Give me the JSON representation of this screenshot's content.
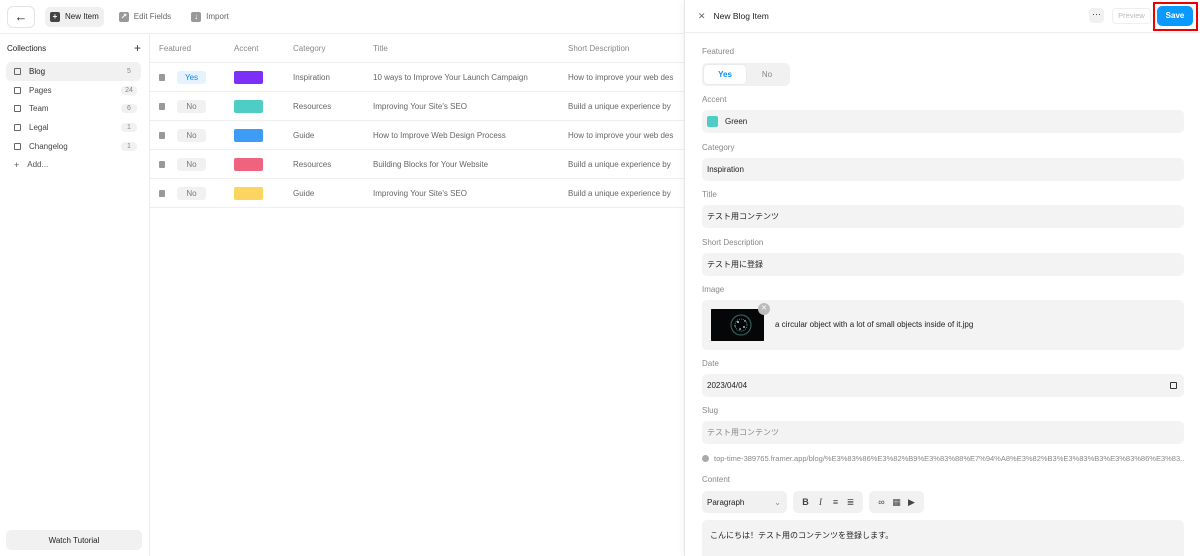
{
  "toolbar": {
    "back_icon": "arrow-left-icon",
    "new_item": "New Item",
    "edit_fields": "Edit Fields",
    "import": "Import"
  },
  "sidebar": {
    "title": "Collections",
    "items": [
      {
        "label": "Blog",
        "count": "5"
      },
      {
        "label": "Pages",
        "count": "24"
      },
      {
        "label": "Team",
        "count": "6"
      },
      {
        "label": "Legal",
        "count": "1"
      },
      {
        "label": "Changelog",
        "count": "1"
      }
    ],
    "add_label": "Add...",
    "watch_tutorial": "Watch Tutorial"
  },
  "table": {
    "headers": [
      "Featured",
      "Accent",
      "Category",
      "Title",
      "Short Description"
    ],
    "rows": [
      {
        "featured": "Yes",
        "accent": "#7b2ff7",
        "category": "Inspiration",
        "title": "10 ways to Improve Your Launch Campaign",
        "desc": "How to improve your web des"
      },
      {
        "featured": "No",
        "accent": "#4ecdc4",
        "category": "Resources",
        "title": "Improving Your Site's SEO",
        "desc": "Build a unique experience by"
      },
      {
        "featured": "No",
        "accent": "#3d9cf5",
        "category": "Guide",
        "title": "How to Improve Web Design Process",
        "desc": "How to improve your web des"
      },
      {
        "featured": "No",
        "accent": "#f0637f",
        "category": "Resources",
        "title": "Building Blocks for Your Website",
        "desc": "Build a unique experience by"
      },
      {
        "featured": "No",
        "accent": "#fbd55f",
        "category": "Guide",
        "title": "Improving Your Site's SEO",
        "desc": "Build a unique experience by"
      }
    ]
  },
  "panel": {
    "title": "New Blog Item",
    "more": "···",
    "preview": "Preview",
    "save": "Save",
    "featured_label": "Featured",
    "featured_yes": "Yes",
    "featured_no": "No",
    "accent_label": "Accent",
    "accent_value": "Green",
    "accent_color": "#4ecdc4",
    "category_label": "Category",
    "category_value": "Inspiration",
    "title_label": "Title",
    "title_value": "テスト用コンテンツ",
    "short_desc_label": "Short Description",
    "short_desc_value": "テスト用に登録",
    "image_label": "Image",
    "image_name": "a circular object with a lot of small objects inside of it.jpg",
    "date_label": "Date",
    "date_value": "2023/04/04",
    "slug_label": "Slug",
    "slug_value": "テスト用コンテンツ",
    "slug_url": "top-time-389765.framer.app/blog/%E3%83%86%E3%82%B9%E3%83%88%E7%94%A8%E3%82%B3%E3%83%B3%E3%83%86%E3%83...",
    "content_label": "Content",
    "paragraph_select": "Paragraph",
    "content_value": "こんにちは！テスト用のコンテンツを登録します。"
  }
}
